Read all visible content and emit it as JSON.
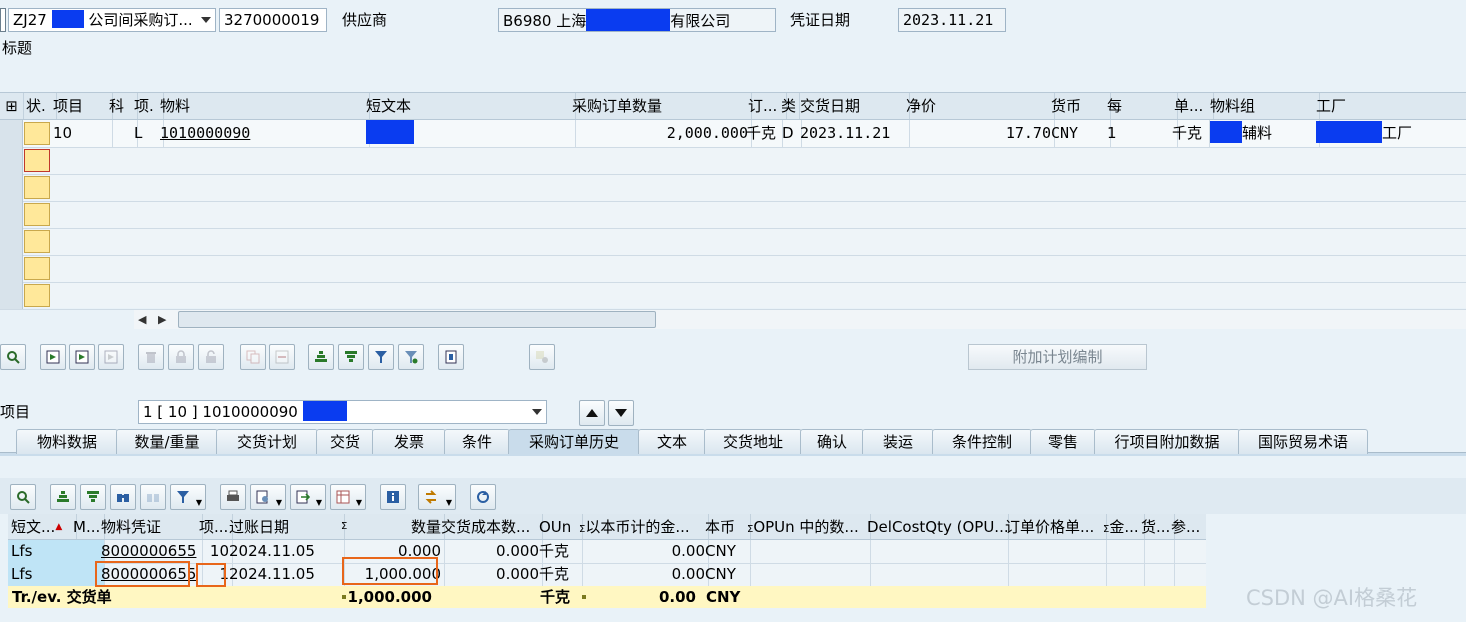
{
  "header": {
    "doc_type_prefix": "ZJ27",
    "doc_type_suffix": "公司间采购订...",
    "po_number": "3270000019",
    "vendor_label": "供应商",
    "vendor_prefix": "B6980 上海",
    "vendor_suffix": "有限公司",
    "doc_date_label": "凭证日期",
    "doc_date": "2023.11.21",
    "title_label": "标题"
  },
  "items_table": {
    "columns": [
      "状.",
      "项目",
      "科",
      "项.",
      "物料",
      "短文本",
      "采购订单数量",
      "订...",
      "类",
      "交货日期",
      "净价",
      "货币",
      "每",
      "单...",
      "物料组",
      "工厂"
    ],
    "rows": [
      {
        "item": "10",
        "acct": "",
        "cat": "L",
        "material": "1010000090",
        "short_text": "",
        "qty": "2,000.000",
        "unit": "千克",
        "type": "D",
        "delivery_date": "2023.11.21",
        "net_price": "17.70",
        "currency": "CNY",
        "per": "1",
        "order_unit": "千克",
        "mat_group_suffix": "辅料",
        "plant_suffix": "工厂"
      }
    ]
  },
  "toolbar": {
    "extra_schedule_button": "附加计划编制"
  },
  "item_selector": {
    "label": "项目",
    "value": "1 [ 10 ] 1010000090"
  },
  "tabs": [
    "物料数据",
    "数量/重量",
    "交货计划",
    "交货",
    "发票",
    "条件",
    "采购订单历史",
    "文本",
    "交货地址",
    "确认",
    "装运",
    "条件控制",
    "零售",
    "行项目附加数据",
    "国际贸易术语"
  ],
  "active_tab": "采购订单历史",
  "history_table": {
    "columns": [
      "短文...",
      "M...",
      "物料凭证",
      "项...",
      "过账日期",
      "数量",
      "交货成本数...",
      "OUn",
      "以本币计的金...",
      "本币",
      "OPUn 中的数...",
      "DelCostQty (OPU...",
      "订单价格单...",
      "金...",
      "货...",
      "参..."
    ],
    "sum_marker": "Σ",
    "rows": [
      {
        "short": "Lfs",
        "m": "",
        "mat_doc": "8000000655",
        "item": "10",
        "post_date": "2024.11.05",
        "qty": "0.000",
        "del_cost": "0.000",
        "oun": "千克",
        "amount": "0.00",
        "currency": "CNY"
      },
      {
        "short": "Lfs",
        "m": "",
        "mat_doc": "8000000655",
        "item": "1",
        "post_date": "2024.11.05",
        "qty": "1,000.000",
        "del_cost": "0.000",
        "oun": "千克",
        "amount": "0.00",
        "currency": "CNY"
      }
    ],
    "total": {
      "label": "Tr./ev. 交货单",
      "qty": "1,000.000",
      "oun": "千克",
      "amount": "0.00",
      "currency": "CNY"
    }
  },
  "watermark": "CSDN @AI格桑花",
  "colors": {
    "redaction": "#0a3cf0",
    "highlight": "#e8661a",
    "total_row": "#fff7c2"
  }
}
